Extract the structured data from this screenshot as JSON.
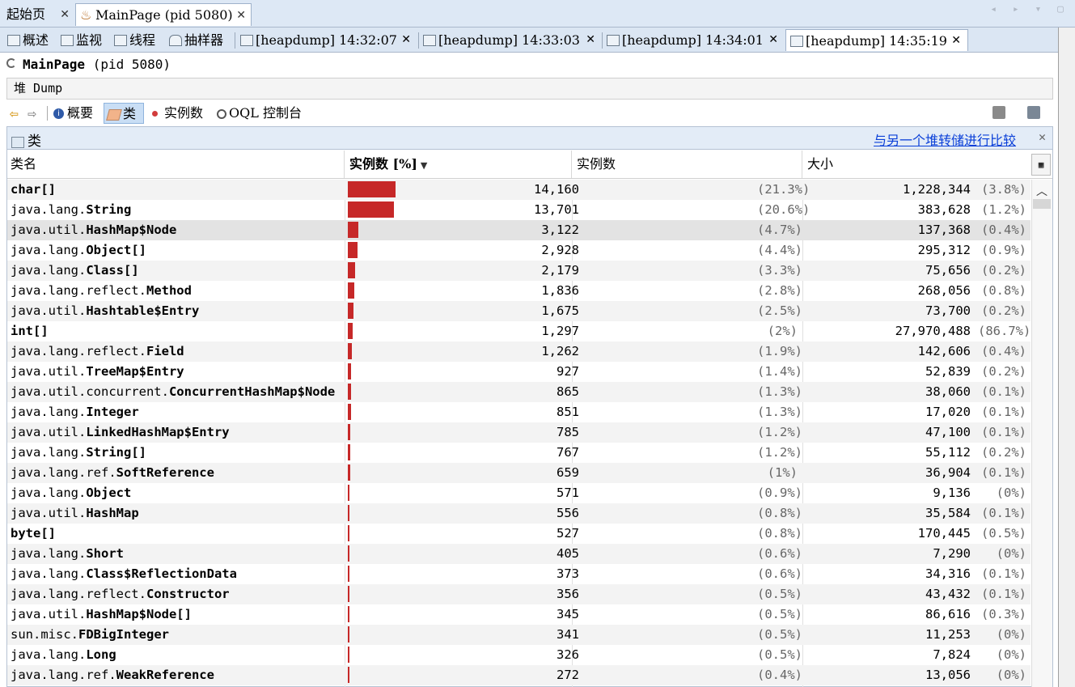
{
  "doc_tabs": [
    {
      "label": "起始页",
      "active": false
    },
    {
      "label": "MainPage (pid 5080)",
      "active": true
    }
  ],
  "inner_tabs": [
    {
      "label": "概述"
    },
    {
      "label": "监视"
    },
    {
      "label": "线程"
    },
    {
      "label": "抽样器"
    },
    {
      "label": "[heapdump] 14:32:07"
    },
    {
      "label": "[heapdump] 14:33:03"
    },
    {
      "label": "[heapdump] 14:34:01"
    },
    {
      "label": "[heapdump] 14:35:19"
    }
  ],
  "process_title": {
    "name": "MainPage",
    "pid": "(pid 5080)"
  },
  "heap_section_label": "堆 Dump",
  "toolbar": {
    "summary_label": "概要",
    "classes_label": "类",
    "instances_label": "实例数",
    "oql_label": "OQL 控制台"
  },
  "panel": {
    "title": "类",
    "compare_link": "与另一个堆转储进行比较"
  },
  "columns": {
    "name": "类名",
    "count_bar": "实例数 [%]",
    "count": "实例数",
    "size": "大小"
  },
  "rows": [
    {
      "pkg": "",
      "cls": "char[]",
      "count": "14,160",
      "count_pct": "(21.3%)",
      "size": "1,228,344",
      "size_pct": "(3.8%)",
      "frac": 0.213
    },
    {
      "pkg": "java.lang.",
      "cls": "String",
      "count": "13,701",
      "count_pct": "(20.6%)",
      "size": "383,628",
      "size_pct": "(1.2%)",
      "frac": 0.206
    },
    {
      "pkg": "java.util.",
      "cls": "HashMap$Node",
      "count": "3,122",
      "count_pct": "(4.7%)",
      "size": "137,368",
      "size_pct": "(0.4%)",
      "frac": 0.047
    },
    {
      "pkg": "java.lang.",
      "cls": "Object[]",
      "count": "2,928",
      "count_pct": "(4.4%)",
      "size": "295,312",
      "size_pct": "(0.9%)",
      "frac": 0.044
    },
    {
      "pkg": "java.lang.",
      "cls": "Class[]",
      "count": "2,179",
      "count_pct": "(3.3%)",
      "size": "75,656",
      "size_pct": "(0.2%)",
      "frac": 0.033
    },
    {
      "pkg": "java.lang.reflect.",
      "cls": "Method",
      "count": "1,836",
      "count_pct": "(2.8%)",
      "size": "268,056",
      "size_pct": "(0.8%)",
      "frac": 0.028
    },
    {
      "pkg": "java.util.",
      "cls": "Hashtable$Entry",
      "count": "1,675",
      "count_pct": "(2.5%)",
      "size": "73,700",
      "size_pct": "(0.2%)",
      "frac": 0.025
    },
    {
      "pkg": "",
      "cls": "int[]",
      "count": "1,297",
      "count_pct": "(2%)",
      "size": "27,970,488",
      "size_pct": "(86.7%)",
      "frac": 0.02
    },
    {
      "pkg": "java.lang.reflect.",
      "cls": "Field",
      "count": "1,262",
      "count_pct": "(1.9%)",
      "size": "142,606",
      "size_pct": "(0.4%)",
      "frac": 0.019
    },
    {
      "pkg": "java.util.",
      "cls": "TreeMap$Entry",
      "count": "927",
      "count_pct": "(1.4%)",
      "size": "52,839",
      "size_pct": "(0.2%)",
      "frac": 0.014
    },
    {
      "pkg": "java.util.concurrent.",
      "cls": "ConcurrentHashMap$Node",
      "count": "865",
      "count_pct": "(1.3%)",
      "size": "38,060",
      "size_pct": "(0.1%)",
      "frac": 0.013
    },
    {
      "pkg": "java.lang.",
      "cls": "Integer",
      "count": "851",
      "count_pct": "(1.3%)",
      "size": "17,020",
      "size_pct": "(0.1%)",
      "frac": 0.013
    },
    {
      "pkg": "java.util.",
      "cls": "LinkedHashMap$Entry",
      "count": "785",
      "count_pct": "(1.2%)",
      "size": "47,100",
      "size_pct": "(0.1%)",
      "frac": 0.012
    },
    {
      "pkg": "java.lang.",
      "cls": "String[]",
      "count": "767",
      "count_pct": "(1.2%)",
      "size": "55,112",
      "size_pct": "(0.2%)",
      "frac": 0.012
    },
    {
      "pkg": "java.lang.ref.",
      "cls": "SoftReference",
      "count": "659",
      "count_pct": "(1%)",
      "size": "36,904",
      "size_pct": "(0.1%)",
      "frac": 0.01
    },
    {
      "pkg": "java.lang.",
      "cls": "Object",
      "count": "571",
      "count_pct": "(0.9%)",
      "size": "9,136",
      "size_pct": "(0%)",
      "frac": 0.009
    },
    {
      "pkg": "java.util.",
      "cls": "HashMap",
      "count": "556",
      "count_pct": "(0.8%)",
      "size": "35,584",
      "size_pct": "(0.1%)",
      "frac": 0.008
    },
    {
      "pkg": "",
      "cls": "byte[]",
      "count": "527",
      "count_pct": "(0.8%)",
      "size": "170,445",
      "size_pct": "(0.5%)",
      "frac": 0.008
    },
    {
      "pkg": "java.lang.",
      "cls": "Short",
      "count": "405",
      "count_pct": "(0.6%)",
      "size": "7,290",
      "size_pct": "(0%)",
      "frac": 0.006
    },
    {
      "pkg": "java.lang.",
      "cls": "Class$ReflectionData",
      "count": "373",
      "count_pct": "(0.6%)",
      "size": "34,316",
      "size_pct": "(0.1%)",
      "frac": 0.006
    },
    {
      "pkg": "java.lang.reflect.",
      "cls": "Constructor",
      "count": "356",
      "count_pct": "(0.5%)",
      "size": "43,432",
      "size_pct": "(0.1%)",
      "frac": 0.005
    },
    {
      "pkg": "java.util.",
      "cls": "HashMap$Node[]",
      "count": "345",
      "count_pct": "(0.5%)",
      "size": "86,616",
      "size_pct": "(0.3%)",
      "frac": 0.005
    },
    {
      "pkg": "sun.misc.",
      "cls": "FDBigInteger",
      "count": "341",
      "count_pct": "(0.5%)",
      "size": "11,253",
      "size_pct": "(0%)",
      "frac": 0.005
    },
    {
      "pkg": "java.lang.",
      "cls": "Long",
      "count": "326",
      "count_pct": "(0.5%)",
      "size": "7,824",
      "size_pct": "(0%)",
      "frac": 0.005
    },
    {
      "pkg": "java.lang.ref.",
      "cls": "WeakReference",
      "count": "272",
      "count_pct": "(0.4%)",
      "size": "13,056",
      "size_pct": "(0%)",
      "frac": 0.004
    }
  ],
  "selected_row_index": 2,
  "colors": {
    "bar": "#c62828",
    "link": "#0a3fd8",
    "selected_row": "#e3e3e3"
  }
}
